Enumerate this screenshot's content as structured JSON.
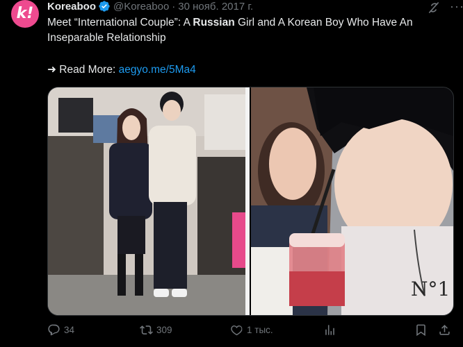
{
  "account": {
    "avatar_letter": "k!",
    "name": "Koreaboo",
    "handle": "@Koreaboo",
    "separator": "·",
    "date": "30 нояб. 2017 г.",
    "avatar_color": "#ee4a8f",
    "verified_color": "#1d9bf0"
  },
  "tweet": {
    "text_before": "Meet “International Couple”: A ",
    "text_bold": "Russian",
    "text_after": " Girl and A Korean Boy Who Have An Inseparable Relationship",
    "readmore_prefix": "➜ Read More: ",
    "link": "aegyo.me/5Ma4",
    "link_color": "#1d9bf0"
  },
  "media": {
    "photos": [
      {
        "name": "store-photo-couple"
      },
      {
        "name": "selfie-photo-couple"
      }
    ]
  },
  "actions": {
    "replies": "34",
    "retweets": "309",
    "likes": "1 тыс.",
    "views": "",
    "icons": [
      "reply-icon",
      "retweet-icon",
      "like-icon",
      "views-icon",
      "bookmark-icon",
      "share-icon"
    ]
  }
}
